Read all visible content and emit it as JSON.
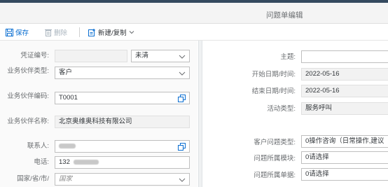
{
  "header": {
    "title": "问题单编辑"
  },
  "toolbar": {
    "save_label": "保存",
    "delete_label": "删除",
    "new_copy_label": "新建/复制"
  },
  "left_form": {
    "voucher_no": {
      "label": "凭证编号:",
      "value": "",
      "status": "未清"
    },
    "partner_type": {
      "label": "业务伙伴类型:",
      "value": "客户"
    },
    "partner_code": {
      "label": "业务伙伴编码:",
      "value": "T0001"
    },
    "partner_name": {
      "label": "业务伙伴名称:",
      "value": "北京奥维奥科技有限公司"
    },
    "contact": {
      "label": "联系人:"
    },
    "phone": {
      "label": "电话:",
      "value": "132"
    },
    "country": {
      "label": "国家/省/市/",
      "placeholder": "国家"
    }
  },
  "right_form": {
    "subject": {
      "label": "主题:",
      "value": ""
    },
    "start_date": {
      "label": "开始日期/时间:",
      "value": "2022-05-16"
    },
    "end_date": {
      "label": "结束日期/时间:",
      "value": "2022-05-16"
    },
    "activity_type": {
      "label": "活动类型:",
      "value": "服务呼叫"
    },
    "issue_type": {
      "label": "客户问题类型:",
      "value": "0操作咨询（日常操作,建议"
    },
    "issue_module": {
      "label": "问题所属模块:",
      "value": "0请选择"
    },
    "issue_doc": {
      "label": "问题所属单据:",
      "value": "0请选择"
    }
  },
  "colors": {
    "accent": "#0a6ed1",
    "shell": "#354a5f"
  }
}
